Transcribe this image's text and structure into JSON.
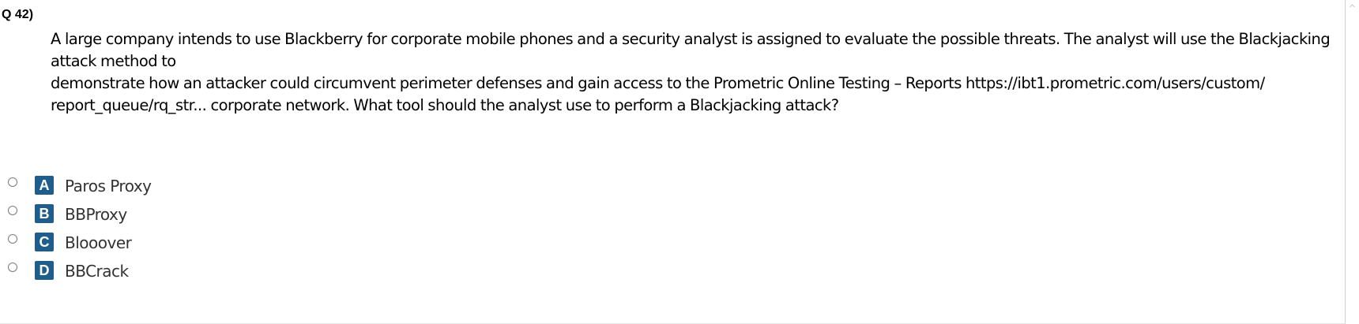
{
  "question": {
    "number": "Q 42)",
    "lines": [
      "A large company intends to use Blackberry for corporate mobile phones and a security analyst is assigned to evaluate the possible threats. The analyst will use the Blackjacking",
      "attack method to",
      "demonstrate how an attacker could circumvent perimeter defenses and gain access to the Prometric Online Testing – Reports https://ibt1.prometric.com/users/custom/",
      "report_queue/rq_str... corporate network. What tool should the analyst use to perform a Blackjacking attack?"
    ]
  },
  "options": [
    {
      "letter": "A",
      "text": "Paros Proxy"
    },
    {
      "letter": "B",
      "text": "BBProxy"
    },
    {
      "letter": "C",
      "text": "Blooover"
    },
    {
      "letter": "D",
      "text": "BBCrack"
    }
  ],
  "colors": {
    "badge": "#1f5d8c",
    "option_text": "#333333"
  },
  "icons": {
    "scroll_up": "chevron-up-icon",
    "radio": "radio-button-icon"
  }
}
